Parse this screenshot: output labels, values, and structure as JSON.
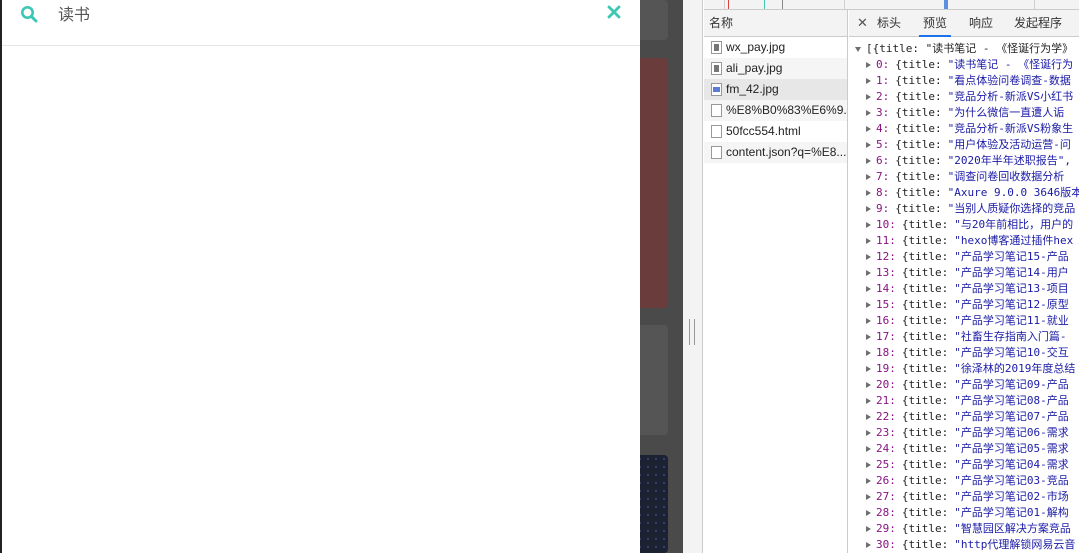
{
  "search": {
    "query": "读书"
  },
  "network": {
    "name_header": "名称",
    "requests": [
      {
        "name": "wx_pay.jpg",
        "icon": "image-file-icon"
      },
      {
        "name": "ali_pay.jpg",
        "icon": "image-file-icon"
      },
      {
        "name": "fm_42.jpg",
        "icon": "image-file-icon"
      },
      {
        "name": "%E8%B0%83%E6%9...",
        "icon": "document-file-icon"
      },
      {
        "name": "50fcc554.html",
        "icon": "document-file-icon"
      },
      {
        "name": "content.json?q=%E8...",
        "icon": "document-file-icon"
      }
    ],
    "tabs": [
      "标头",
      "预览",
      "响应",
      "发起程序"
    ],
    "active_tab": "预览",
    "accent_color": "#1a73e8"
  },
  "preview": {
    "root_line": "[{title: \"读书笔记 - 《怪诞行为学》",
    "items": [
      {
        "index": "0:",
        "title": "\"读书笔记 - 《怪诞行为"
      },
      {
        "index": "1:",
        "title": "\"看点体验问卷调查-数据"
      },
      {
        "index": "2:",
        "title": "\"竞品分析-新派VS小红书"
      },
      {
        "index": "3:",
        "title": "\"为什么微信一直遭人诟"
      },
      {
        "index": "4:",
        "title": "\"竞品分析-新派VS粉象生"
      },
      {
        "index": "5:",
        "title": "\"用户体验及活动运营-问"
      },
      {
        "index": "6:",
        "title": "\"2020年半年述职报告\","
      },
      {
        "index": "7:",
        "title": "\"调查问卷回收数据分析"
      },
      {
        "index": "8:",
        "title": "\"Axure 9.0.0 3646版本"
      },
      {
        "index": "9:",
        "title": "\"当别人质疑你选择的竞品"
      },
      {
        "index": "10:",
        "title": "\"与20年前相比，用户的"
      },
      {
        "index": "11:",
        "title": "\"hexo博客通过插件hex"
      },
      {
        "index": "12:",
        "title": "\"产品学习笔记15-产品"
      },
      {
        "index": "13:",
        "title": "\"产品学习笔记14-用户"
      },
      {
        "index": "14:",
        "title": "\"产品学习笔记13-项目"
      },
      {
        "index": "15:",
        "title": "\"产品学习笔记12-原型"
      },
      {
        "index": "16:",
        "title": "\"产品学习笔记11-就业"
      },
      {
        "index": "17:",
        "title": "\"社畜生存指南入门篇-"
      },
      {
        "index": "18:",
        "title": "\"产品学习笔记10-交互"
      },
      {
        "index": "19:",
        "title": "\"徐泽林的2019年度总结"
      },
      {
        "index": "20:",
        "title": "\"产品学习笔记09-产品"
      },
      {
        "index": "21:",
        "title": "\"产品学习笔记08-产品"
      },
      {
        "index": "22:",
        "title": "\"产品学习笔记07-产品"
      },
      {
        "index": "23:",
        "title": "\"产品学习笔记06-需求"
      },
      {
        "index": "24:",
        "title": "\"产品学习笔记05-需求"
      },
      {
        "index": "25:",
        "title": "\"产品学习笔记04-需求"
      },
      {
        "index": "26:",
        "title": "\"产品学习笔记03-竞品"
      },
      {
        "index": "27:",
        "title": "\"产品学习笔记02-市场"
      },
      {
        "index": "28:",
        "title": "\"产品学习笔记01-解构"
      },
      {
        "index": "29:",
        "title": "\"智慧园区解决方案竞品"
      },
      {
        "index": "30:",
        "title": "\"http代理解锁网易云音"
      }
    ],
    "key_label": "{title:"
  },
  "colors": {
    "search_accent": "#3ec7b4",
    "json_key": "#881280",
    "json_string": "#1a1aa6"
  }
}
